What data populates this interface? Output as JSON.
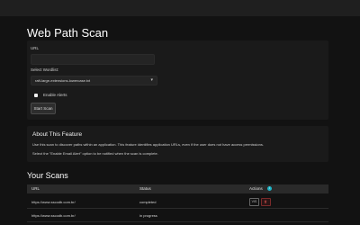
{
  "page": {
    "title": "Web Path Scan"
  },
  "form": {
    "url_label": "URL",
    "url_value": "",
    "wordlist_label": "Select Wordlist:",
    "wordlist_selected": "raft-large-extensions-lowercase.txt",
    "alerts_label": "Enable Alerts",
    "alerts_checked": false,
    "start_label": "Start Scan"
  },
  "about": {
    "title": "About This Feature",
    "p1": "Use this scan to discover paths within an application. This feature identifies application URLs, even if the user does not have access permissions.",
    "p2": "Select the \"Enable Email Alert\" option to be notified when the scan is complete."
  },
  "scans": {
    "title": "Your Scans",
    "headers": {
      "url": "URL",
      "status": "Status",
      "actions": "Actions"
    },
    "rows": [
      {
        "url": "https://www.sscodb.com.br/",
        "status": "completed",
        "view": "VIS"
      },
      {
        "url": "https://www.sscodb.com.br/",
        "status": "in progress"
      }
    ]
  },
  "colors": {
    "accent": "#1eb6c8",
    "danger": "#c0392b",
    "background": "#121212",
    "card": "#1a1a1a"
  },
  "icons": {
    "info": "info-icon",
    "delete": "trash-icon",
    "select": "chevron-down-icon"
  }
}
